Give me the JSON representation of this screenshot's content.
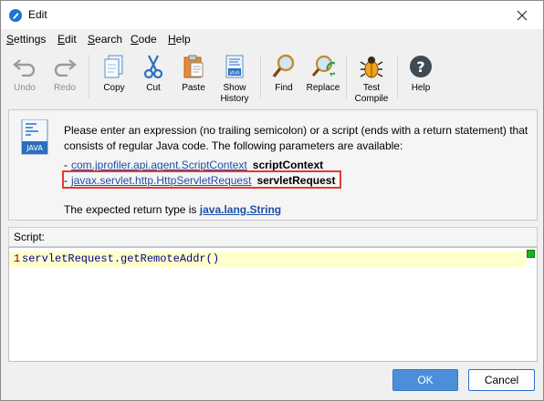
{
  "window": {
    "title": "Edit"
  },
  "menu": [
    {
      "label": "Settings",
      "mnemonic": "S",
      "rest": "ettings"
    },
    {
      "label": "Edit",
      "mnemonic": "E",
      "rest": "dit"
    },
    {
      "label": "Search",
      "mnemonic": "S",
      "rest": "earch"
    },
    {
      "label": "Code",
      "mnemonic": "C",
      "rest": "ode"
    },
    {
      "label": "Help",
      "mnemonic": "H",
      "rest": "elp"
    }
  ],
  "toolbar": {
    "undo": "Undo",
    "redo": "Redo",
    "copy": "Copy",
    "cut": "Cut",
    "paste": "Paste",
    "show_history": "Show\nHistory",
    "find": "Find",
    "replace": "Replace",
    "test_compile": "Test\nCompile",
    "help": "Help",
    "icons": [
      "undo-icon",
      "redo-icon",
      "copy-icon",
      "cut-icon",
      "paste-icon",
      "history-icon",
      "find-icon",
      "replace-icon",
      "bug-icon",
      "help-icon"
    ]
  },
  "info": {
    "icon_label": "JAVA",
    "description": "Please enter an expression (no trailing semicolon) or a script (ends with a return statement) that consists of regular Java code. The following parameters are available:",
    "params": [
      {
        "type": "com.jprofiler.api.agent.ScriptContext",
        "name": "scriptContext"
      },
      {
        "type": "javax.servlet.http.HttpServletRequest",
        "name": "servletRequest"
      }
    ],
    "return_prefix": "The expected return type is",
    "return_type": "java.lang.String"
  },
  "script": {
    "label": "Script:",
    "line_number": "1",
    "code": "servletRequest.getRemoteAddr()"
  },
  "buttons": {
    "ok": "OK",
    "cancel": "Cancel"
  },
  "colors": {
    "accent": "#4a8fd8",
    "link": "#1f4fa8",
    "highlight_border": "#e53935",
    "current_line": "#ffffcc",
    "status_ok": "#1ab31a"
  }
}
